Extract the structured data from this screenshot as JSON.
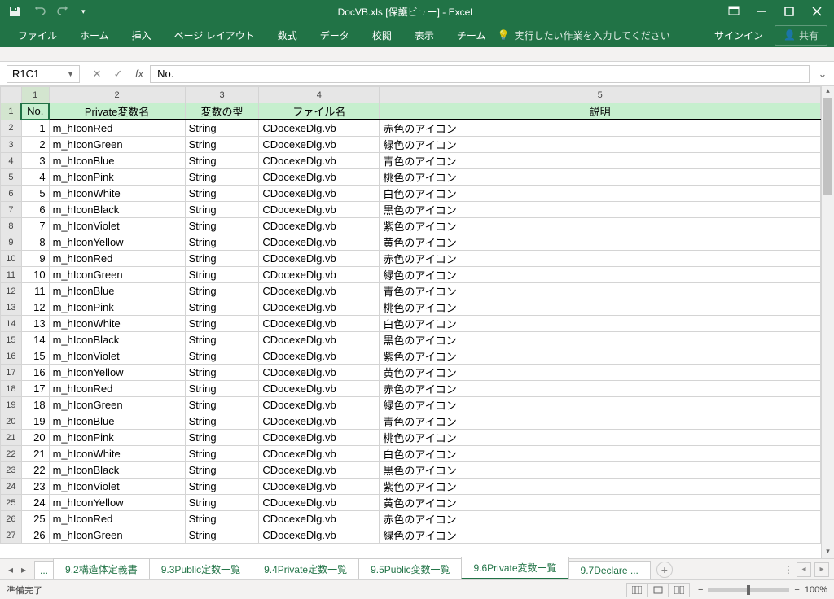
{
  "titlebar": {
    "title": "DocVB.xls  [保護ビュー] - Excel"
  },
  "ribbon": {
    "tabs": [
      "ファイル",
      "ホーム",
      "挿入",
      "ページ レイアウト",
      "数式",
      "データ",
      "校閲",
      "表示",
      "チーム"
    ],
    "tellme": "実行したい作業を入力してください",
    "signin": "サインイン",
    "share": "共有"
  },
  "formula": {
    "namebox": "R1C1",
    "value": "No."
  },
  "columns": {
    "hdr_nums": [
      "1",
      "2",
      "3",
      "4",
      "5"
    ],
    "widths": [
      34,
      170,
      92,
      150,
      560
    ],
    "headers": [
      "No.",
      "Private変数名",
      "変数の型",
      "ファイル名",
      "説明"
    ]
  },
  "rows": [
    {
      "no": 1,
      "var": "m_hIconRed",
      "type": "String",
      "file": "CDocexeDlg.vb",
      "desc": "赤色のアイコン"
    },
    {
      "no": 2,
      "var": "m_hIconGreen",
      "type": "String",
      "file": "CDocexeDlg.vb",
      "desc": "緑色のアイコン"
    },
    {
      "no": 3,
      "var": "m_hIconBlue",
      "type": "String",
      "file": "CDocexeDlg.vb",
      "desc": "青色のアイコン"
    },
    {
      "no": 4,
      "var": "m_hIconPink",
      "type": "String",
      "file": "CDocexeDlg.vb",
      "desc": "桃色のアイコン"
    },
    {
      "no": 5,
      "var": "m_hIconWhite",
      "type": "String",
      "file": "CDocexeDlg.vb",
      "desc": "白色のアイコン"
    },
    {
      "no": 6,
      "var": "m_hIconBlack",
      "type": "String",
      "file": "CDocexeDlg.vb",
      "desc": "黒色のアイコン"
    },
    {
      "no": 7,
      "var": "m_hIconViolet",
      "type": "String",
      "file": "CDocexeDlg.vb",
      "desc": "紫色のアイコン"
    },
    {
      "no": 8,
      "var": "m_hIconYellow",
      "type": "String",
      "file": "CDocexeDlg.vb",
      "desc": "黄色のアイコン"
    },
    {
      "no": 9,
      "var": "m_hIconRed",
      "type": "String",
      "file": "CDocexeDlg.vb",
      "desc": "赤色のアイコン"
    },
    {
      "no": 10,
      "var": "m_hIconGreen",
      "type": "String",
      "file": "CDocexeDlg.vb",
      "desc": "緑色のアイコン"
    },
    {
      "no": 11,
      "var": "m_hIconBlue",
      "type": "String",
      "file": "CDocexeDlg.vb",
      "desc": "青色のアイコン"
    },
    {
      "no": 12,
      "var": "m_hIconPink",
      "type": "String",
      "file": "CDocexeDlg.vb",
      "desc": "桃色のアイコン"
    },
    {
      "no": 13,
      "var": "m_hIconWhite",
      "type": "String",
      "file": "CDocexeDlg.vb",
      "desc": "白色のアイコン"
    },
    {
      "no": 14,
      "var": "m_hIconBlack",
      "type": "String",
      "file": "CDocexeDlg.vb",
      "desc": "黒色のアイコン"
    },
    {
      "no": 15,
      "var": "m_hIconViolet",
      "type": "String",
      "file": "CDocexeDlg.vb",
      "desc": "紫色のアイコン"
    },
    {
      "no": 16,
      "var": "m_hIconYellow",
      "type": "String",
      "file": "CDocexeDlg.vb",
      "desc": "黄色のアイコン"
    },
    {
      "no": 17,
      "var": "m_hIconRed",
      "type": "String",
      "file": "CDocexeDlg.vb",
      "desc": "赤色のアイコン"
    },
    {
      "no": 18,
      "var": "m_hIconGreen",
      "type": "String",
      "file": "CDocexeDlg.vb",
      "desc": "緑色のアイコン"
    },
    {
      "no": 19,
      "var": "m_hIconBlue",
      "type": "String",
      "file": "CDocexeDlg.vb",
      "desc": "青色のアイコン"
    },
    {
      "no": 20,
      "var": "m_hIconPink",
      "type": "String",
      "file": "CDocexeDlg.vb",
      "desc": "桃色のアイコン"
    },
    {
      "no": 21,
      "var": "m_hIconWhite",
      "type": "String",
      "file": "CDocexeDlg.vb",
      "desc": "白色のアイコン"
    },
    {
      "no": 22,
      "var": "m_hIconBlack",
      "type": "String",
      "file": "CDocexeDlg.vb",
      "desc": "黒色のアイコン"
    },
    {
      "no": 23,
      "var": "m_hIconViolet",
      "type": "String",
      "file": "CDocexeDlg.vb",
      "desc": "紫色のアイコン"
    },
    {
      "no": 24,
      "var": "m_hIconYellow",
      "type": "String",
      "file": "CDocexeDlg.vb",
      "desc": "黄色のアイコン"
    },
    {
      "no": 25,
      "var": "m_hIconRed",
      "type": "String",
      "file": "CDocexeDlg.vb",
      "desc": "赤色のアイコン"
    },
    {
      "no": 26,
      "var": "m_hIconGreen",
      "type": "String",
      "file": "CDocexeDlg.vb",
      "desc": "緑色のアイコン"
    }
  ],
  "sheet_tabs": {
    "items": [
      "9.2構造体定義書",
      "9.3Public定数一覧",
      "9.4Private定数一覧",
      "9.5Public変数一覧",
      "9.6Private変数一覧",
      "9.7Declare"
    ],
    "active_index": 4,
    "left_ellipsis": "...",
    "right_ellipsis": "..."
  },
  "status": {
    "status": "準備完了",
    "zoom": "100%"
  }
}
